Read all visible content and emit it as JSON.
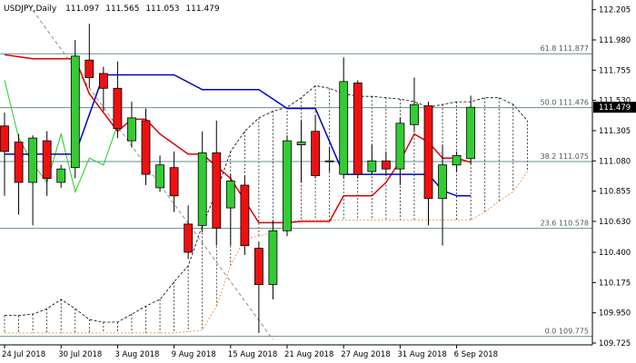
{
  "header": {
    "symbol": "USDJPY,Daily",
    "open": "111.097",
    "high": "111.565",
    "low": "111.053",
    "close": "111.479"
  },
  "colors": {
    "background": "#ffffff",
    "bull": "#33cc33",
    "bear": "#ee1111",
    "candle_outline": "#000000",
    "kijun": "#0000cc",
    "tenkan": "#dd0000",
    "chikou": "#22cc22",
    "fib_line": "#6b8e8e",
    "cloud_hatch": "#000000",
    "senkou_b": "#ee8833",
    "trendline": "#777777",
    "current_price_tag": "#000000"
  },
  "chart_data": {
    "type": "candlestick",
    "title": "USDJPY,Daily",
    "ylim": [
      109.725,
      112.25
    ],
    "y_ticks": [
      "112.205",
      "111.980",
      "111.755",
      "111.530",
      "111.305",
      "111.080",
      "110.855",
      "110.630",
      "110.400",
      "110.175",
      "109.950",
      "109.725"
    ],
    "x_ticks": [
      {
        "label": "24 Jul 2018",
        "index": 0
      },
      {
        "label": "30 Jul 2018",
        "index": 4
      },
      {
        "label": "3 Aug 2018",
        "index": 8
      },
      {
        "label": "9 Aug 2018",
        "index": 12
      },
      {
        "label": "15 Aug 2018",
        "index": 16
      },
      {
        "label": "21 Aug 2018",
        "index": 20
      },
      {
        "label": "27 Aug 2018",
        "index": 24
      },
      {
        "label": "31 Aug 2018",
        "index": 28
      },
      {
        "label": "6 Sep 2018",
        "index": 32
      }
    ],
    "candles": [
      {
        "o": 111.34,
        "h": 111.44,
        "l": 110.82,
        "c": 111.15
      },
      {
        "o": 111.22,
        "h": 111.28,
        "l": 110.68,
        "c": 110.92
      },
      {
        "o": 110.92,
        "h": 111.27,
        "l": 110.6,
        "c": 111.25
      },
      {
        "o": 111.23,
        "h": 111.3,
        "l": 110.82,
        "c": 110.95
      },
      {
        "o": 110.92,
        "h": 111.05,
        "l": 110.88,
        "c": 111.02
      },
      {
        "o": 111.03,
        "h": 111.98,
        "l": 110.95,
        "c": 111.86
      },
      {
        "o": 111.83,
        "h": 112.1,
        "l": 111.62,
        "c": 111.7
      },
      {
        "o": 111.73,
        "h": 111.78,
        "l": 111.45,
        "c": 111.62
      },
      {
        "o": 111.62,
        "h": 111.82,
        "l": 111.25,
        "c": 111.32
      },
      {
        "o": 111.23,
        "h": 111.52,
        "l": 111.18,
        "c": 111.4
      },
      {
        "o": 111.38,
        "h": 111.47,
        "l": 110.9,
        "c": 110.98
      },
      {
        "o": 110.88,
        "h": 111.12,
        "l": 110.85,
        "c": 111.05
      },
      {
        "o": 111.03,
        "h": 111.15,
        "l": 110.7,
        "c": 110.82
      },
      {
        "o": 110.61,
        "h": 110.75,
        "l": 110.35,
        "c": 110.4
      },
      {
        "o": 110.6,
        "h": 111.3,
        "l": 110.55,
        "c": 111.14
      },
      {
        "o": 111.14,
        "h": 111.38,
        "l": 110.45,
        "c": 110.58
      },
      {
        "o": 110.73,
        "h": 110.98,
        "l": 110.45,
        "c": 110.93
      },
      {
        "o": 110.9,
        "h": 110.97,
        "l": 110.38,
        "c": 110.45
      },
      {
        "o": 110.43,
        "h": 110.48,
        "l": 109.8,
        "c": 110.16
      },
      {
        "o": 110.16,
        "h": 110.64,
        "l": 110.05,
        "c": 110.56
      },
      {
        "o": 110.56,
        "h": 111.27,
        "l": 110.52,
        "c": 111.23
      },
      {
        "o": 111.2,
        "h": 111.38,
        "l": 110.92,
        "c": 111.22
      },
      {
        "o": 111.3,
        "h": 111.42,
        "l": 110.95,
        "c": 110.97
      },
      {
        "o": 111.08,
        "h": 111.18,
        "l": 111.0,
        "c": 111.08
      },
      {
        "o": 110.98,
        "h": 111.85,
        "l": 110.95,
        "c": 111.67
      },
      {
        "o": 111.66,
        "h": 111.68,
        "l": 110.95,
        "c": 110.98
      },
      {
        "o": 111.0,
        "h": 111.2,
        "l": 110.98,
        "c": 111.08
      },
      {
        "o": 111.08,
        "h": 111.15,
        "l": 110.97,
        "c": 111.02
      },
      {
        "o": 111.02,
        "h": 111.4,
        "l": 110.9,
        "c": 111.36
      },
      {
        "o": 111.35,
        "h": 111.7,
        "l": 111.3,
        "c": 111.5
      },
      {
        "o": 111.49,
        "h": 111.52,
        "l": 110.6,
        "c": 110.8
      },
      {
        "o": 110.8,
        "h": 111.2,
        "l": 110.45,
        "c": 111.05
      },
      {
        "o": 111.05,
        "h": 111.15,
        "l": 111.0,
        "c": 111.12
      },
      {
        "o": 111.097,
        "h": 111.565,
        "l": 111.053,
        "c": 111.479
      }
    ],
    "kijun_sen": [
      [
        0,
        111.13
      ],
      [
        5,
        111.13
      ],
      [
        7,
        111.72
      ],
      [
        12,
        111.72
      ],
      [
        14,
        111.61
      ],
      [
        18,
        111.61
      ],
      [
        20,
        111.47
      ],
      [
        22,
        111.47
      ],
      [
        24,
        110.98
      ],
      [
        30,
        110.98
      ],
      [
        31,
        110.86
      ],
      [
        32,
        110.82
      ],
      [
        33,
        110.82
      ]
    ],
    "tenkan_sen": [
      [
        0,
        111.87
      ],
      [
        2,
        111.84
      ],
      [
        3,
        111.84
      ],
      [
        5,
        111.84
      ],
      [
        6,
        111.58
      ],
      [
        8,
        111.3
      ],
      [
        9,
        111.39
      ],
      [
        10,
        111.39
      ],
      [
        11,
        111.28
      ],
      [
        13,
        111.13
      ],
      [
        14,
        111.13
      ],
      [
        16,
        110.95
      ],
      [
        18,
        110.62
      ],
      [
        20,
        110.62
      ],
      [
        21,
        110.63
      ],
      [
        23,
        110.63
      ],
      [
        24,
        110.82
      ],
      [
        26,
        110.82
      ],
      [
        27,
        110.92
      ],
      [
        28,
        111.08
      ],
      [
        29,
        111.28
      ],
      [
        30,
        111.22
      ],
      [
        31,
        111.1
      ],
      [
        32,
        111.1
      ],
      [
        33,
        111.07
      ]
    ],
    "chikou_span": [
      [
        0,
        111.68
      ],
      [
        1,
        111.25
      ],
      [
        2,
        111.06
      ],
      [
        3,
        110.92
      ],
      [
        4,
        111.28
      ],
      [
        5,
        110.85
      ],
      [
        6,
        111.1
      ],
      [
        7,
        111.05
      ],
      [
        8,
        111.35
      ]
    ],
    "fib_levels": [
      {
        "label": "61.8  111.877",
        "value": 111.877
      },
      {
        "label": "50.0  111.476",
        "value": 111.476
      },
      {
        "label": "38.2  111.075",
        "value": 111.075
      },
      {
        "label": "23.6  110.578",
        "value": 110.578
      },
      {
        "label": "0.0  109.775",
        "value": 109.775
      }
    ],
    "cloud_upper": [
      [
        0,
        109.93
      ],
      [
        1,
        109.93
      ],
      [
        2,
        109.94
      ],
      [
        3,
        109.98
      ],
      [
        4,
        110.05
      ],
      [
        5,
        109.98
      ],
      [
        6,
        109.9
      ],
      [
        7,
        109.88
      ],
      [
        8,
        109.88
      ],
      [
        9,
        109.94
      ],
      [
        10,
        110.0
      ],
      [
        11,
        110.05
      ],
      [
        12,
        110.18
      ],
      [
        13,
        110.3
      ],
      [
        14,
        110.6
      ],
      [
        15,
        110.85
      ],
      [
        16,
        111.15
      ],
      [
        17,
        111.3
      ],
      [
        18,
        111.4
      ],
      [
        19,
        111.45
      ],
      [
        20,
        111.48
      ],
      [
        21,
        111.55
      ],
      [
        22,
        111.64
      ],
      [
        23,
        111.62
      ],
      [
        24,
        111.58
      ],
      [
        25,
        111.56
      ],
      [
        26,
        111.56
      ],
      [
        27,
        111.55
      ],
      [
        28,
        111.54
      ],
      [
        29,
        111.52
      ],
      [
        30,
        111.48
      ],
      [
        31,
        111.5
      ],
      [
        32,
        111.52
      ],
      [
        33,
        111.52
      ],
      [
        34,
        111.55
      ],
      [
        35,
        111.55
      ],
      [
        36,
        111.5
      ],
      [
        37,
        111.38
      ]
    ],
    "cloud_lower": [
      [
        0,
        109.8
      ],
      [
        12,
        109.8
      ],
      [
        14,
        109.82
      ],
      [
        15,
        110.0
      ],
      [
        16,
        110.3
      ],
      [
        17,
        110.5
      ],
      [
        18,
        110.52
      ],
      [
        19,
        110.55
      ],
      [
        20,
        110.62
      ],
      [
        21,
        110.64
      ],
      [
        22,
        110.64
      ],
      [
        33,
        110.64
      ],
      [
        34,
        110.7
      ],
      [
        35,
        110.78
      ],
      [
        36,
        110.85
      ],
      [
        37,
        111.0
      ]
    ],
    "current_price": 111.479,
    "trendline": [
      [
        2,
        112.2
      ],
      [
        19,
        109.75
      ]
    ],
    "grid": false
  }
}
